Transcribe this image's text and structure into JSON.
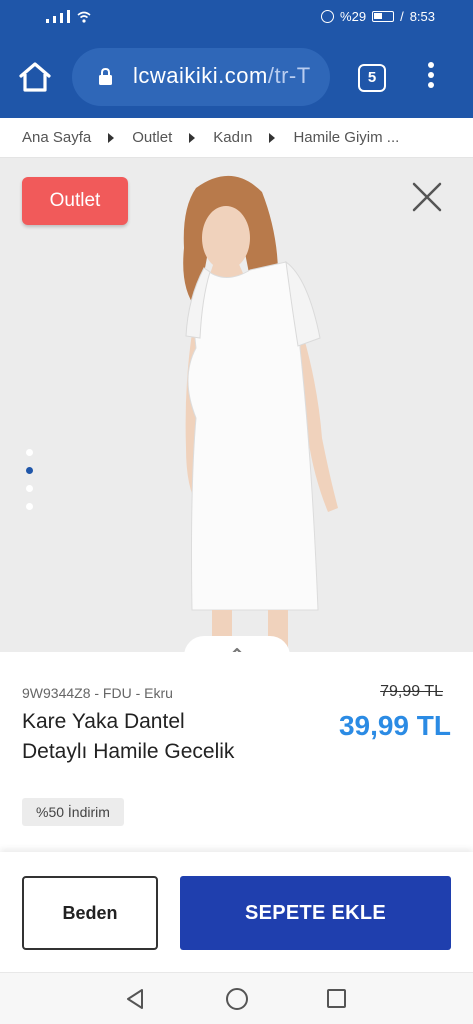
{
  "status": {
    "battery": "%29",
    "time": "8:53"
  },
  "browser": {
    "url_domain": "lcwaikiki.com",
    "url_path": "/tr-T",
    "tab_count": "5",
    "icons": [
      "home-icon",
      "lock-icon",
      "tabs-icon",
      "menu-icon"
    ]
  },
  "breadcrumb": [
    "Ana Sayfa",
    "Outlet",
    "Kadın",
    "Hamile Giyim ..."
  ],
  "gallery": {
    "badge": "Outlet",
    "image_count": 4,
    "active_image": 2
  },
  "product": {
    "sku": "9W9344Z8 - FDU - Ekru",
    "name": "Kare Yaka Dantel Detaylı Hamile Gecelik",
    "old_price": "79,99 TL",
    "price": "39,99 TL",
    "discount": "%50 İndirim"
  },
  "actions": {
    "size_label": "Beden",
    "add_to_cart_label": "SEPETE EKLE"
  },
  "colors": {
    "brand_blue": "#1f56a9",
    "badge_red": "#f15a5a",
    "price_blue": "#2b8be4",
    "cart_button": "#1f3fae"
  }
}
